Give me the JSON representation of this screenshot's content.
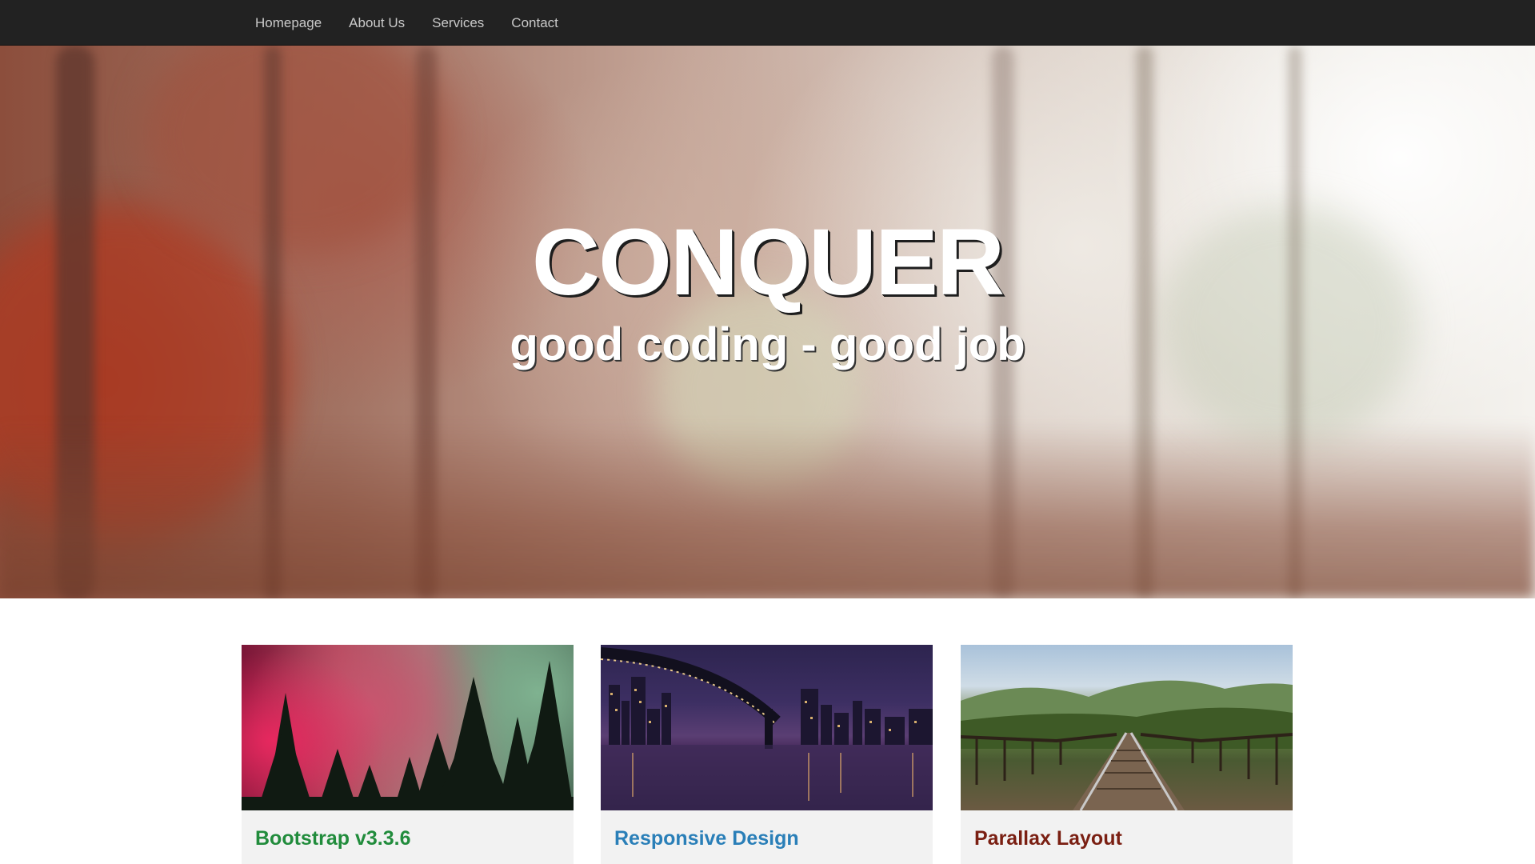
{
  "nav": {
    "items": [
      {
        "label": "Homepage"
      },
      {
        "label": "About Us"
      },
      {
        "label": "Services"
      },
      {
        "label": "Contact"
      }
    ]
  },
  "hero": {
    "title": "CONQUER",
    "subtitle": "good coding - good job"
  },
  "cards": [
    {
      "title": "Bootstrap v3.3.6",
      "title_color": "#218c3c",
      "image": "aurora-forest-photo"
    },
    {
      "title": "Responsive Design",
      "title_color": "#2a7fb8",
      "image": "city-bridge-night-photo"
    },
    {
      "title": "Parallax Layout",
      "title_color": "#7a1f12",
      "image": "railway-bridge-photo"
    }
  ],
  "colors": {
    "navbar_bg": "#222222",
    "nav_text": "#c9c9c9",
    "card_bg": "#f2f2f2"
  }
}
